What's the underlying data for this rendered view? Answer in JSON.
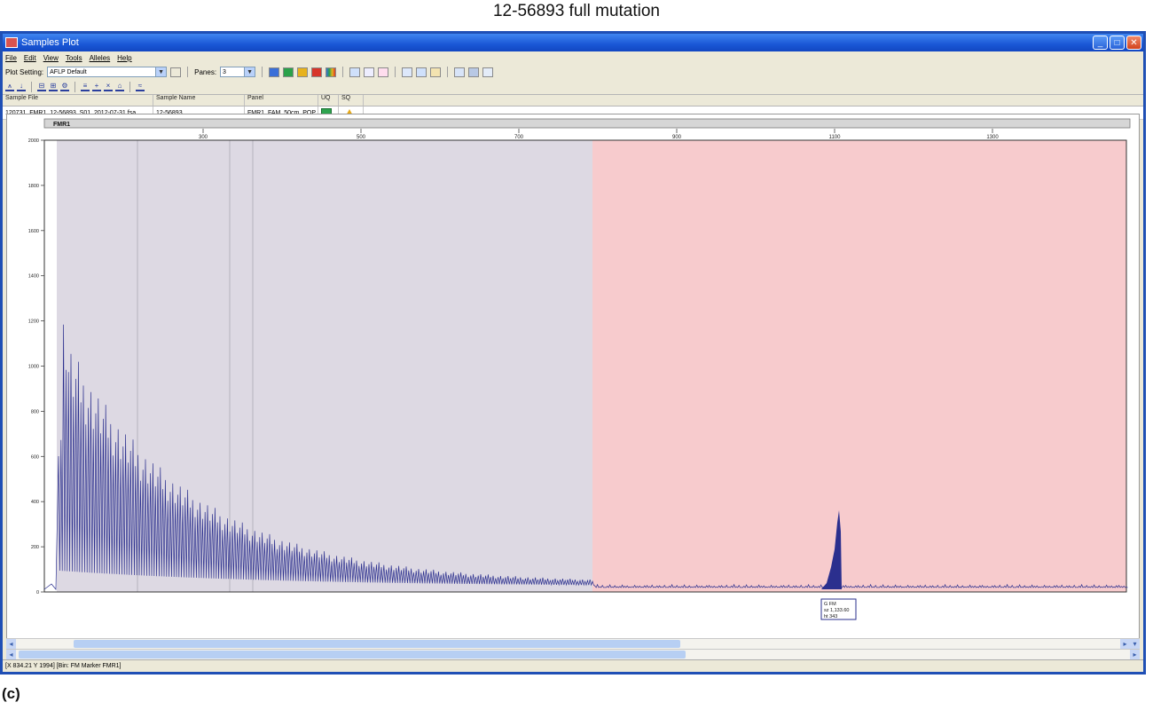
{
  "figure": {
    "title": "12-56893 full mutation",
    "label": "(c)"
  },
  "window": {
    "title": "Samples Plot"
  },
  "menu": [
    "File",
    "Edit",
    "View",
    "Tools",
    "Alleles",
    "Help"
  ],
  "toolbar": {
    "plot_setting_label": "Plot Setting:",
    "plot_setting_value": "AFLP Default",
    "panes_label": "Panes:",
    "panes_value": "3"
  },
  "grid": {
    "headers": [
      "Sample File",
      "Sample Name",
      "Panel",
      "UQ",
      "SQ"
    ],
    "row": {
      "sample_file": "120731_FMR1_12-56893_S01_2012-07-31.fsa",
      "sample_name": "12-56893",
      "panel": "FMR1_FAM_50cm_POP",
      "uq_color": "#2ea44f",
      "sq_color": "#e6a817"
    }
  },
  "plot": {
    "marker_bar_label": "FMR1",
    "x_ticks": [
      "300",
      "500",
      "700",
      "900",
      "1100",
      "1300"
    ],
    "y_ticks": [
      "0",
      "200",
      "400",
      "600",
      "800",
      "1000",
      "1200",
      "1400",
      "1600",
      "1800",
      "2000"
    ],
    "peak_label": {
      "line1": "G FM",
      "line2": "sz 1,133.60",
      "line3": "ht 343"
    },
    "colors": {
      "gray_bin": "#ddd9e3",
      "pink_bin": "#f7cbcd",
      "trace": "#2b2f8e"
    }
  },
  "status": {
    "text": "[X 834.21  Y 1994]  [Bin: FM Marker FMR1]"
  }
}
